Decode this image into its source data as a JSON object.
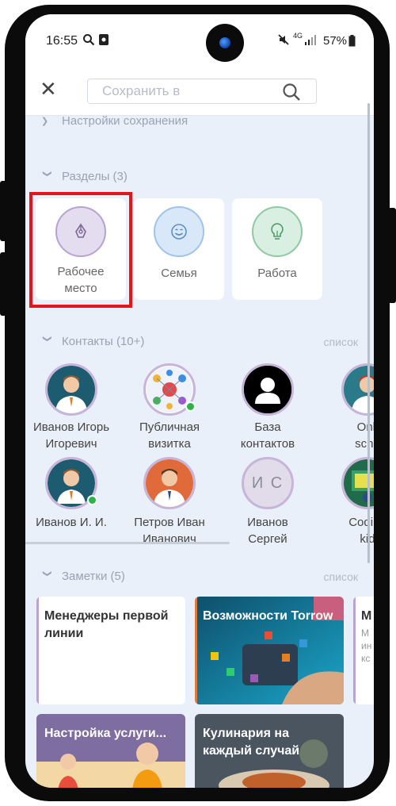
{
  "status": {
    "time": "16:55",
    "battery": "57%",
    "network": "4G"
  },
  "topbar": {
    "search_placeholder": "Сохранить в"
  },
  "save_settings": {
    "label": "Настройки сохранения"
  },
  "sections": {
    "header": "Разделы (3)",
    "items": [
      {
        "label_line1": "Рабочее",
        "label_line2": "место",
        "icon": "pen-icon",
        "color": "#e4dcef",
        "border": "#b6a3d0"
      },
      {
        "label_line1": "Семья",
        "label_line2": "",
        "icon": "smile-icon",
        "color": "#d9e8f8",
        "border": "#9fc4ea"
      },
      {
        "label_line1": "Работа",
        "label_line2": "",
        "icon": "lightbulb-icon",
        "color": "#d8efe1",
        "border": "#8fc9a2"
      }
    ]
  },
  "contacts": {
    "header": "Контакты (10+)",
    "list_link": "список",
    "items": [
      {
        "line1": "Иванов Игорь",
        "line2": "Игоревич",
        "type": "photo-man"
      },
      {
        "line1": "Публичная",
        "line2": "визитка",
        "type": "network"
      },
      {
        "line1": "База",
        "line2": "контактов",
        "type": "person-black"
      },
      {
        "line1": "Onli",
        "line2": "scho",
        "type": "photo-man"
      },
      {
        "line1": "Иванов И. И.",
        "line2": "",
        "type": "photo-man"
      },
      {
        "line1": "Петров Иван",
        "line2": "Иванович",
        "type": "photo-man-orange"
      },
      {
        "line1": "Иванов",
        "line2": "Сергей",
        "type": "initials",
        "initials": "И С"
      },
      {
        "line1": "Coding",
        "line2": "kid",
        "type": "coding"
      }
    ]
  },
  "notes": {
    "header": "Заметки (5)",
    "list_link": "список",
    "items": [
      {
        "title": "Менеджеры первой линии"
      },
      {
        "title": "Возможности Torrow"
      },
      {
        "title": "М"
      },
      {
        "title": "Настройка услуги..."
      },
      {
        "title": "Кулинария на каждый случай"
      }
    ],
    "partial_text": [
      "М",
      "ин",
      "кс"
    ]
  }
}
